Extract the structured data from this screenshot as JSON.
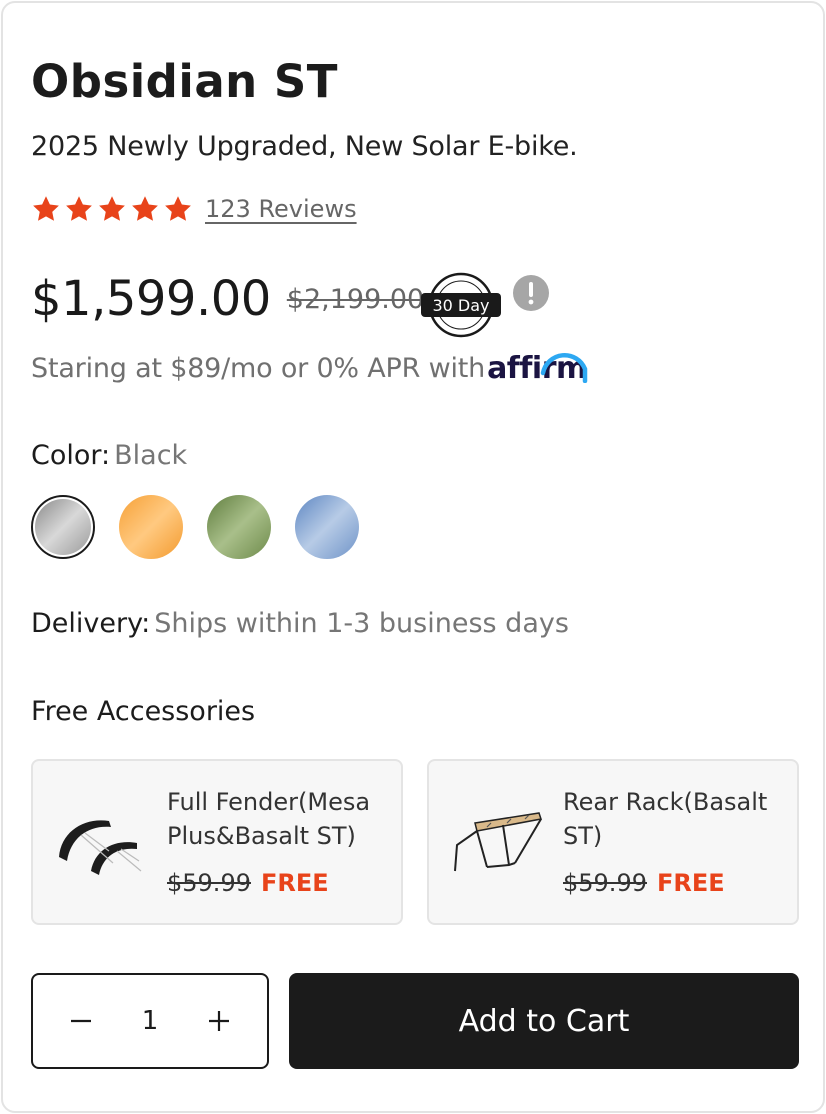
{
  "product": {
    "title": "Obsidian ST",
    "subtitle": "2025 Newly Upgraded, New Solar E-bike.",
    "rating": 5,
    "reviews_label": "123 Reviews"
  },
  "pricing": {
    "price": "$1,599.00",
    "original_price": "$2,199.00",
    "guarantee_badge": "30 Day",
    "financing_text": "Staring at $89/mo or 0% APR with",
    "financing_brand": "affirm"
  },
  "color": {
    "label": "Color:",
    "selected": "Black",
    "swatches": [
      {
        "name": "Black",
        "gradient": [
          "#8a8a8a",
          "#d8d8d8",
          "#9a9a9a"
        ]
      },
      {
        "name": "Orange",
        "gradient": [
          "#f6a036",
          "#ffc980",
          "#f39a2e"
        ]
      },
      {
        "name": "Green",
        "gradient": [
          "#5f7d3e",
          "#a9bf8a",
          "#6d8a4a"
        ]
      },
      {
        "name": "Blue",
        "gradient": [
          "#5d86c2",
          "#b7cbe6",
          "#6e93c8"
        ]
      }
    ]
  },
  "delivery": {
    "label": "Delivery:",
    "value": "Ships within 1-3 business days"
  },
  "accessories": {
    "title": "Free Accessories",
    "items": [
      {
        "name": "Full Fender(Mesa Plus&Basalt ST)",
        "old_price": "$59.99",
        "price": "FREE"
      },
      {
        "name": "Rear Rack(Basalt ST)",
        "old_price": "$59.99",
        "price": "FREE"
      }
    ]
  },
  "cart": {
    "quantity": "1",
    "add_label": "Add to Cart"
  },
  "colors": {
    "star": "#e8431a",
    "free": "#e8431a",
    "button_bg": "#1b1b1b",
    "affirm_blue": "#2da8f2"
  }
}
